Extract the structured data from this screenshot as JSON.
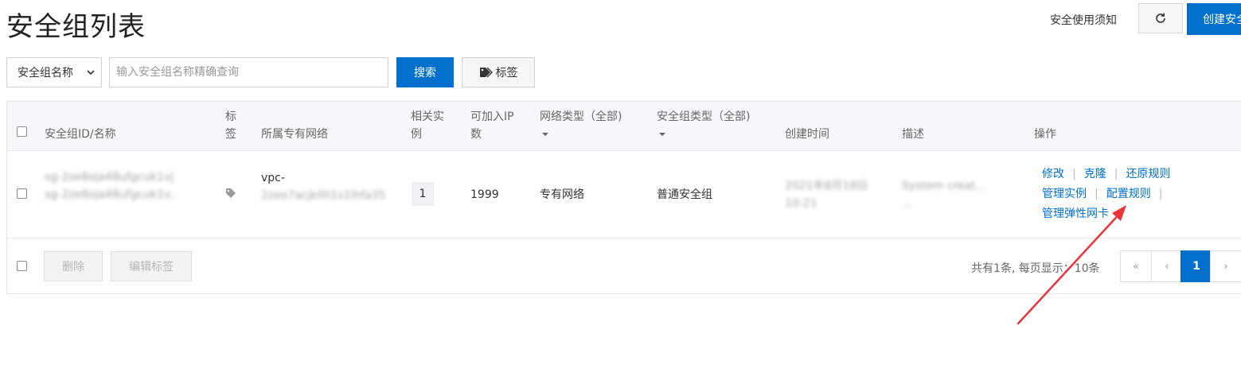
{
  "header": {
    "title": "安全组列表",
    "notice_link": "安全使用须知",
    "create_button": "创建安全"
  },
  "toolbar": {
    "filter_select": "安全组名称",
    "search_placeholder": "输入安全组名称精确查询",
    "search_button": "搜索",
    "tag_button": "标签"
  },
  "table": {
    "headers": {
      "id_name": "安全组ID/名称",
      "tag_line1": "标",
      "tag_line2": "签",
      "vpc": "所属专有网络",
      "instances_line1": "相关实",
      "instances_line2": "例",
      "ip_line1": "可加入IP",
      "ip_line2": "数",
      "network_type": "网络类型（全部)",
      "sg_type": "安全组类型（全部)",
      "created": "创建时间",
      "desc": "描述",
      "actions": "操作"
    },
    "rows": [
      {
        "id_line1": "sg-2ze8oja48ufgcuk1vj",
        "id_line2": "sg-2ze8oja48ufgcuk1v..",
        "vpc_line1": "vpc-",
        "vpc_line2": "2zeo7acjk0li1s1lhfa35",
        "instances": "1",
        "ip_count": "1999",
        "network_type": "专有网络",
        "sg_type": "普通安全组",
        "created_line1": "2021年8月18日",
        "created_line2": "10:21",
        "desc_line1": "System creat...",
        "desc_line2": "...",
        "actions": {
          "modify": "修改",
          "clone": "克隆",
          "restore": "还原规则",
          "manage_instances": "管理实例",
          "config_rules": "配置规则",
          "manage_eni": "管理弹性网卡"
        }
      }
    ]
  },
  "footer": {
    "delete_button": "删除",
    "edit_tags_button": "编辑标签",
    "summary": "共有1条, 每页显示：10条",
    "pager": {
      "first": "«",
      "prev": "‹",
      "current": "1",
      "next": "›"
    }
  },
  "colors": {
    "primary": "#0070cc",
    "annotation_arrow": "#e8353a"
  }
}
